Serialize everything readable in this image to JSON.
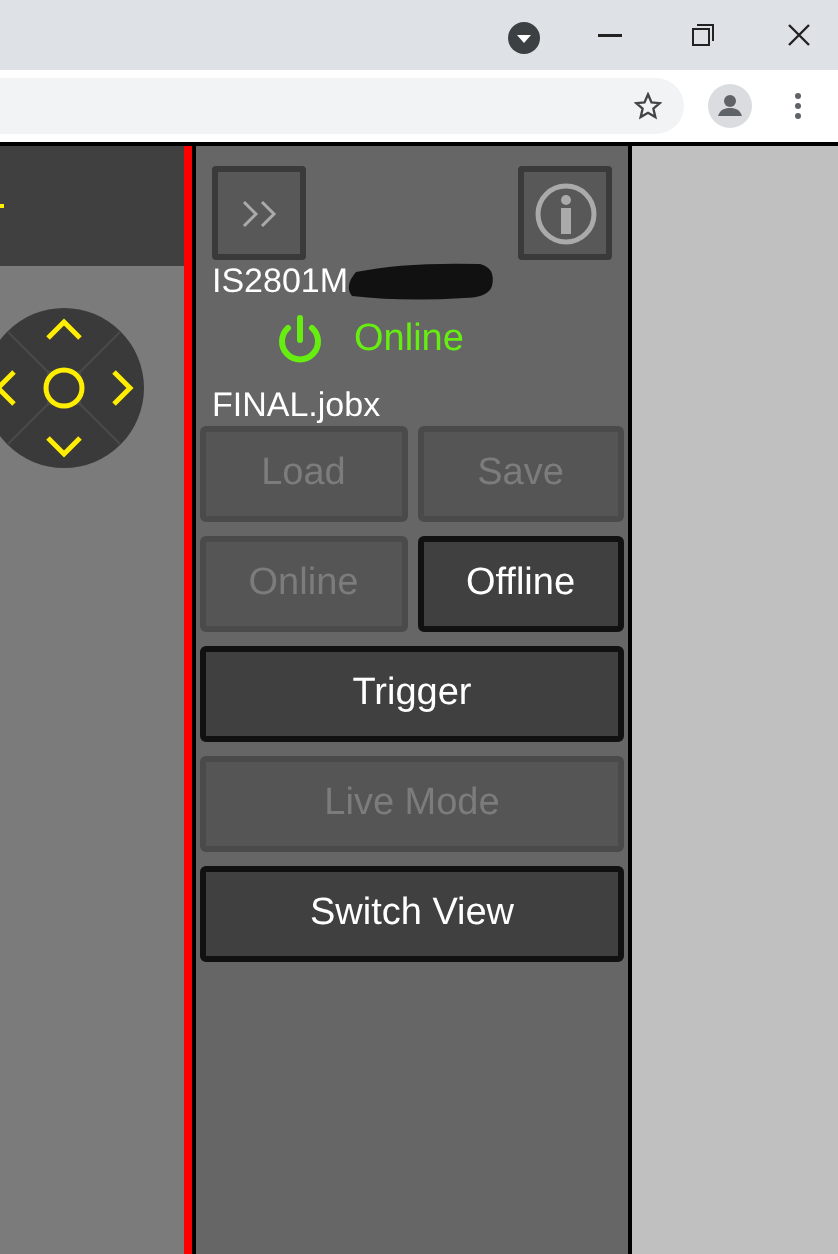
{
  "device": {
    "name": "IS2801M",
    "status": "Online",
    "online": true
  },
  "job": {
    "file": "FINAL.jobx"
  },
  "buttons": [
    {
      "label": "Load",
      "disabled": true,
      "wide": false
    },
    {
      "label": "Save",
      "disabled": true,
      "wide": false
    },
    {
      "label": "Online",
      "disabled": true,
      "wide": false
    },
    {
      "label": "Offline",
      "disabled": false,
      "wide": false
    },
    {
      "label": "Trigger",
      "disabled": false,
      "wide": true
    },
    {
      "label": "Live Mode",
      "disabled": true,
      "wide": true
    },
    {
      "label": "Switch View",
      "disabled": false,
      "wide": true
    }
  ]
}
